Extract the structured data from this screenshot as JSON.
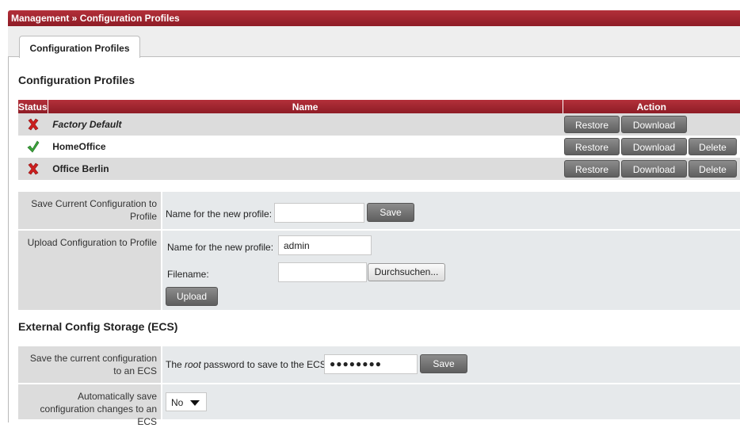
{
  "breadcrumb": "Management » Configuration Profiles",
  "tabs": [
    {
      "label": "Configuration Profiles"
    }
  ],
  "section_profiles": {
    "title": "Configuration Profiles"
  },
  "table": {
    "headers": {
      "status": "Status",
      "name": "Name",
      "action": "Action"
    },
    "rows": [
      {
        "status": "inactive",
        "status_icon": "x-icon",
        "name": "Factory Default",
        "italic": true,
        "actions": [
          "Restore",
          "Download"
        ]
      },
      {
        "status": "active",
        "status_icon": "check-icon",
        "name": "HomeOffice",
        "italic": false,
        "actions": [
          "Restore",
          "Download",
          "Delete"
        ]
      },
      {
        "status": "inactive",
        "status_icon": "x-icon",
        "name": "Office Berlin",
        "italic": false,
        "actions": [
          "Restore",
          "Download",
          "Delete"
        ]
      }
    ]
  },
  "save_current": {
    "label": "Save Current Configuration to Profile",
    "field_label": "Name for the new profile:",
    "value": "",
    "button": "Save"
  },
  "upload": {
    "label": "Upload Configuration to Profile",
    "name_label": "Name for the new profile:",
    "name_value": "admin",
    "file_label": "Filename:",
    "file_value": "",
    "browse_button": "Durchsuchen...",
    "upload_button": "Upload"
  },
  "section_ecs": {
    "title": "External Config Storage (ECS)"
  },
  "ecs_save": {
    "label": "Save the current configuration to an ECS",
    "field_label_pre": "The ",
    "field_label_em": "root",
    "field_label_post": " password to save to the ECS:",
    "password_mask": "●●●●●●●●",
    "button": "Save"
  },
  "ecs_auto": {
    "label": "Automatically save configuration changes to an ECS",
    "selected": "No"
  },
  "colors": {
    "header_red": "#a3242f",
    "row_grey": "#dcdcdc",
    "form_bg": "#e6e9eb",
    "button_grey": "#707070",
    "status_ok": "#3aa23a",
    "status_off": "#cc1f1f"
  }
}
